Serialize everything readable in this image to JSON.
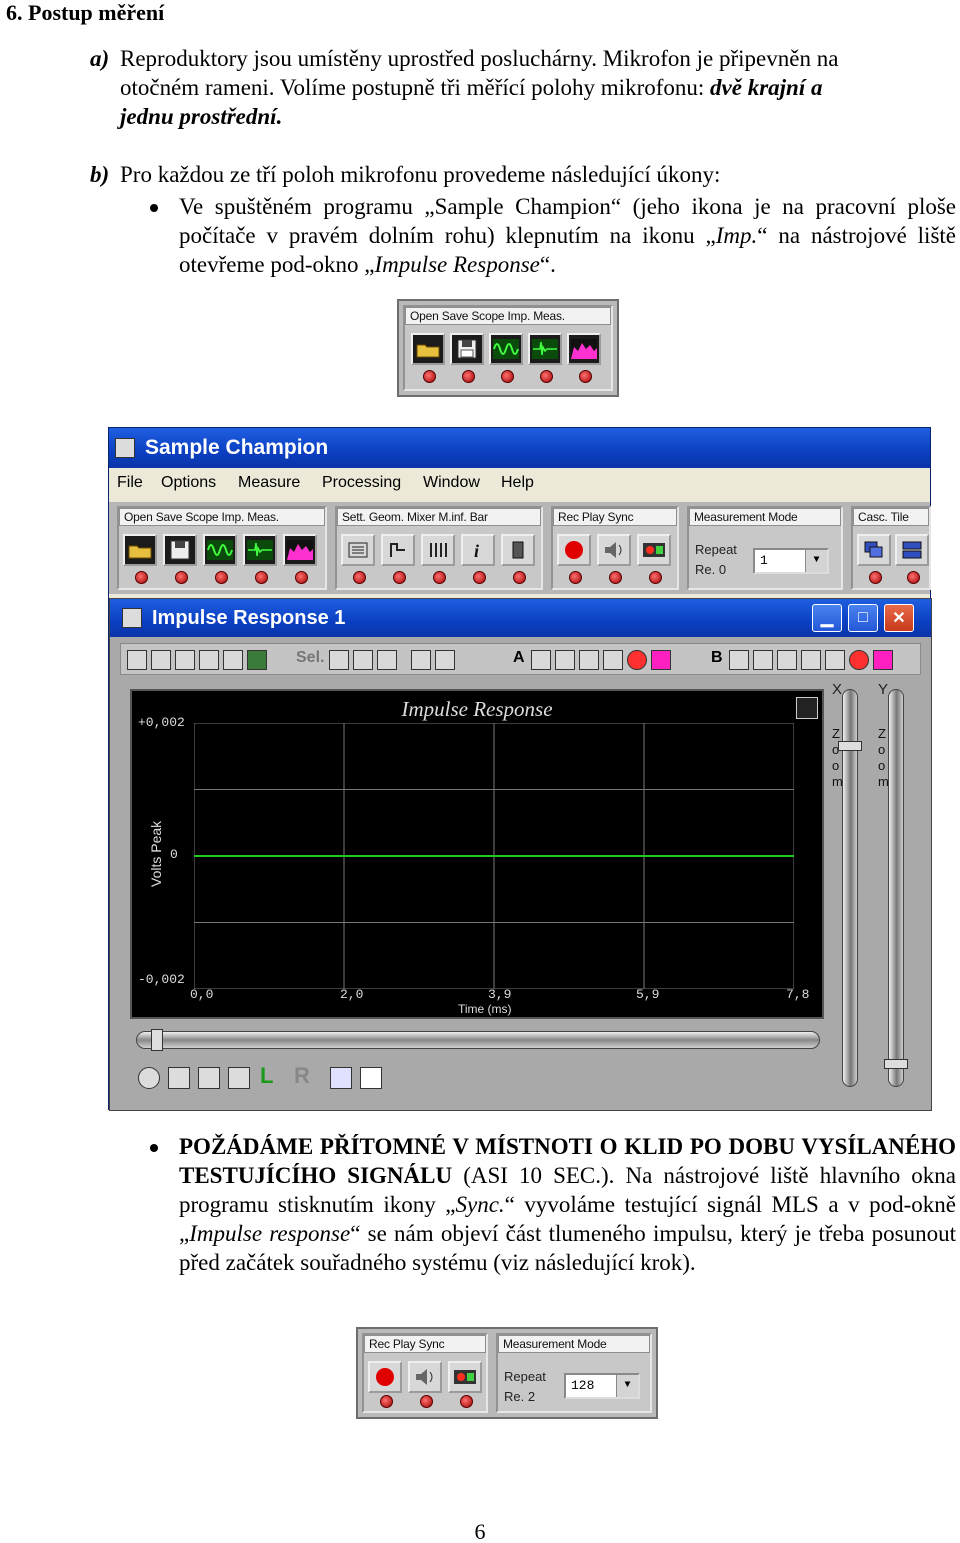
{
  "heading": "6.  Postup měření",
  "para_a": {
    "label": "a)",
    "line1": "Reproduktory jsou umístěny uprostřed posluchárny. Mikrofon je připevněn na",
    "line2_plain": "otočném rameni. Volíme postupně tři měřící polohy mikrofonu: ",
    "line2_bold": "dvě krajní a",
    "line3_bold": "jednu prostřední."
  },
  "para_b": {
    "label": "b)",
    "text": "Pro každou ze tří poloh mikrofonu provedeme následující úkony:"
  },
  "bullet1": {
    "p1": "Ve spuštěném programu „Sample Champion“ (jeho ikona je na pracovní ploše počítače v pravém dolním rohu) klepnutím na ikonu „",
    "imp": "Imp.",
    "p2": "“ na nástrojové liště otevřeme pod-okno „",
    "ir": "Impulse Response",
    "p3": "“."
  },
  "toolbar1": {
    "title": "Open Save Scope Imp. Meas."
  },
  "app": {
    "title": "Sample Champion",
    "menu": [
      "File",
      "Options",
      "Measure",
      "Processing",
      "Window",
      "Help"
    ],
    "groups": [
      {
        "title": "Open Save Scope Imp. Meas."
      },
      {
        "title": "Sett. Geom. Mixer M.inf. Bar"
      },
      {
        "title": "Rec  Play  Sync"
      },
      {
        "title": "Measurement Mode"
      },
      {
        "title": "Casc. Tile"
      }
    ],
    "repeat_label": "Repeat",
    "re_label": "Re. 0",
    "repeat_value": "1"
  },
  "subwindow": {
    "title": "Impulse Response 1",
    "row_labels": {
      "sel": "Sel.",
      "a": "A",
      "b": "B"
    },
    "zoom_x_axis": "X",
    "zoom_y_axis": "Y",
    "zoom_word": [
      "Z",
      "o",
      "o",
      "m"
    ],
    "bottom_labels": {
      "l": "L",
      "r": "R"
    }
  },
  "chart_data": {
    "type": "line",
    "title": "Impulse Response",
    "xlabel": "Time (ms)",
    "ylabel": "Volts Peak",
    "x_ticks": [
      "0,0",
      "2,0",
      "3,9",
      "5,9",
      "7,8"
    ],
    "y_ticks": [
      "+0,002",
      "0",
      "-0,002"
    ],
    "xlim": [
      0.0,
      7.8
    ],
    "ylim": [
      -0.002,
      0.002
    ],
    "grid": true,
    "series": [
      {
        "x": [
          0.0,
          7.8
        ],
        "y": [
          0.0,
          0.0
        ],
        "color": "#1ec81e"
      }
    ],
    "background": "#000000"
  },
  "bullet2": {
    "caps": "POŽÁDÁME PŘÍTOMNÉ V MÍSTNOTI O KLID PO DOBU VYSÍLANÉHO TESTUJÍCÍHO SIGNÁLU",
    "p1": " (ASI 10 SEC.). Na nástrojové liště hlavního okna programu stisknutím ikony „",
    "sync": "Sync.",
    "p2": "“ vyvoláme testující signál MLS a v pod-okně „",
    "ir": "Impulse response",
    "p3": "“ se nám objeví část tlumeného impulsu, který je třeba posunout  před začátek souřadného systému (viz následující krok)."
  },
  "toolbar2": {
    "group1_title": "Rec  Play  Sync",
    "group2_title": "Measurement Mode",
    "repeat_label": "Repeat",
    "re_label": "Re. 2",
    "repeat_value": "128"
  },
  "page_number": "6"
}
